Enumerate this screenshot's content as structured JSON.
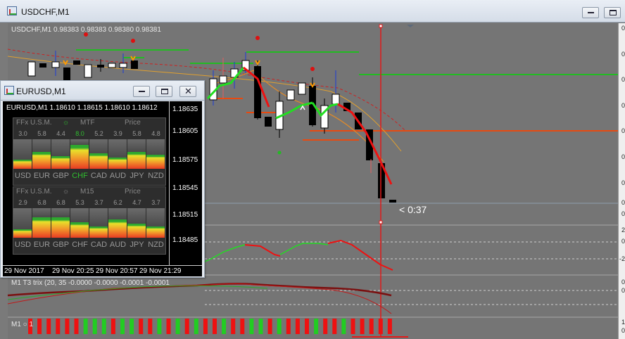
{
  "main_window": {
    "title": "USDCHF,M1",
    "chart_header": "USDCHF,M1  0.98383 0.98383 0.98380 0.98381",
    "countdown": "< 0:37",
    "right_scale_labels": [
      "0",
      "0",
      "0",
      "0",
      "0",
      "0",
      "0",
      "0",
      "0"
    ],
    "indicator1_scale": [
      "2",
      "0",
      "-2"
    ],
    "indicator2_label": "M1 T3 trix (20, 35 -0.0000 -0.0000 -0.0001 -0.0001",
    "indicator2_scale": [
      "0",
      "0"
    ],
    "indicator3_label": "M1 ○ 1",
    "indicator3_scale": [
      "1",
      "0"
    ]
  },
  "eur_window": {
    "title": "EURUSD,M1",
    "chart_header": "EURUSD,M1  1.18610 1.18615 1.18610 1.18612",
    "price_labels": [
      "1.18635",
      "1.18605",
      "1.18575",
      "1.18545",
      "1.18515",
      "1.18485"
    ],
    "current_price": "1.18612",
    "time_labels": [
      "29 Nov 2017",
      "29 Nov 20:25",
      "29 Nov 20:57",
      "29 Nov 21:29"
    ]
  },
  "meter_top": {
    "name": "FFx U.S.M.",
    "tf": "MTF",
    "price": "Price",
    "values": [
      "3.0",
      "5.8",
      "4.4",
      "8.0",
      "5.2",
      "3.9",
      "5.8",
      "4.8"
    ],
    "currencies": [
      "USD",
      "EUR",
      "GBP",
      "CHF",
      "CAD",
      "AUD",
      "JPY",
      "NZD"
    ],
    "highlight_color": "#2fbf2f"
  },
  "meter_bottom": {
    "name": "FFx U.S.M.",
    "tf": "M15",
    "price": "Price",
    "values": [
      "2.9",
      "6.8",
      "6.8",
      "5.3",
      "3.7",
      "6.2",
      "4.7",
      "3.7"
    ],
    "currencies": [
      "USD",
      "EUR",
      "GBP",
      "CHF",
      "CAD",
      "AUD",
      "JPY",
      "NZD"
    ]
  },
  "colors": {
    "bull": "#ffffff",
    "bear": "#000000",
    "trend_up": "#22dd22",
    "trend_down": "#ee1111",
    "level_green": "#22bb22",
    "level_red": "#e84a10",
    "vline": "#e21a1a"
  }
}
